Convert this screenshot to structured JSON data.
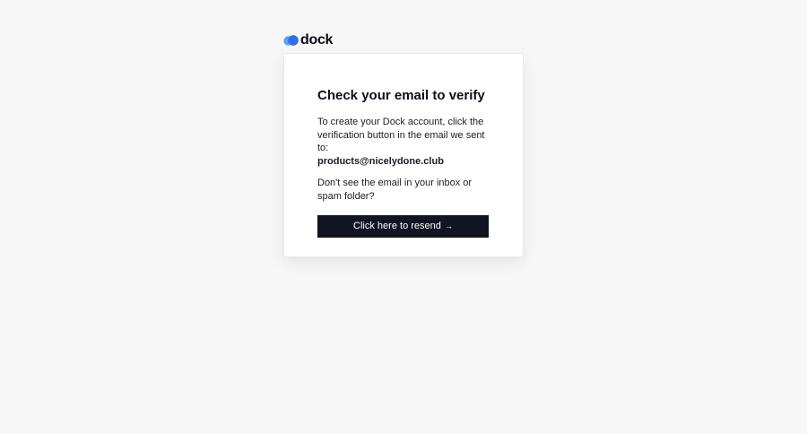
{
  "brand": {
    "name": "dock",
    "logo_icon": "cloud-logo-icon",
    "logo_colors": [
      "#2f6fe8",
      "#5aa3f5"
    ]
  },
  "card": {
    "title": "Check your email to verify",
    "instructions": "To create your Dock account, click the verification button in the email we sent to:",
    "email": "products@nicelydone.club",
    "help_text": "Don't see the email in your inbox or spam folder?",
    "resend_label": "Click here to resend",
    "resend_arrow": "→"
  },
  "colors": {
    "background": "#f7f7f7",
    "card": "#ffffff",
    "button": "#111521",
    "button_text": "#ffffff"
  }
}
